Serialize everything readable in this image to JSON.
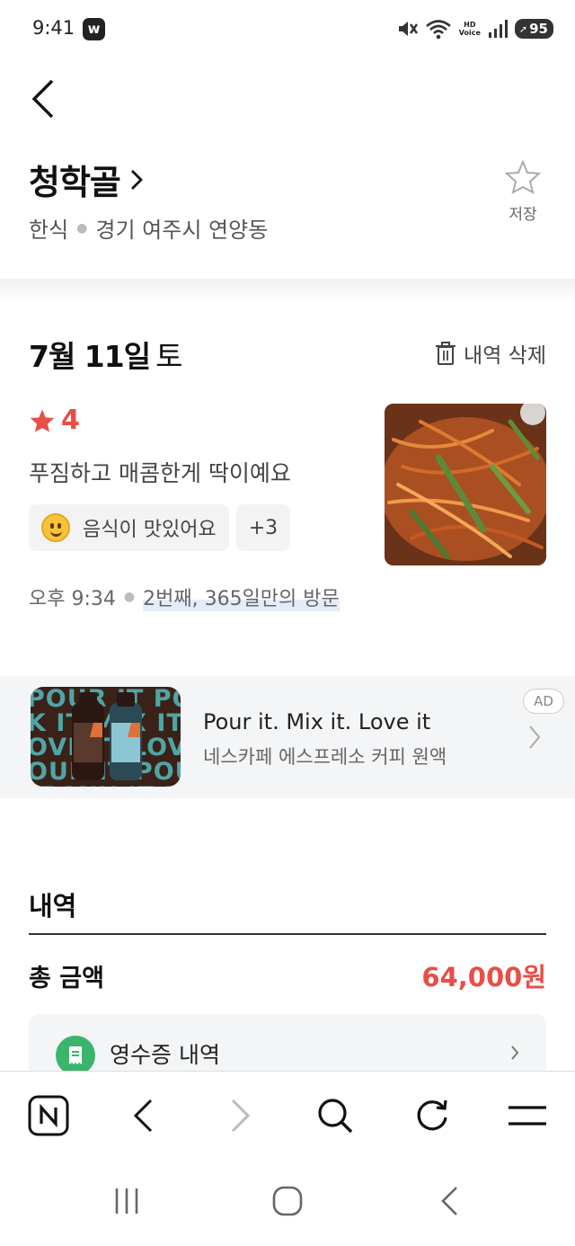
{
  "status_bar": {
    "time": "9:41",
    "app_badge": "w",
    "hd_voice": "HD\nVoice",
    "battery": "95"
  },
  "header": {
    "restaurant_name": "청학골",
    "category": "한식",
    "location": "경기 여주시 연양동",
    "save_label": "저장"
  },
  "visit": {
    "date": "7월 11일",
    "day_of_week": "토",
    "delete_label": "내역 삭제",
    "rating": "4",
    "review": "푸짐하고 매콤한게 딱이예요",
    "chips": [
      {
        "label": "음식이 맛있어요"
      },
      {
        "label": "+3"
      }
    ],
    "time": "오후 9:34",
    "visit_count": "2번째, 365일만의 방문"
  },
  "ad": {
    "title": "Pour it. Mix it. Love it",
    "description": "네스카페 에스프레소 커피 원액",
    "badge": "AD",
    "thumb_text": "POUR IT POUR\nK IT MIX IT MI\nOVE IT LOVE\nOUR IT POUR\nIT MIX IT MI"
  },
  "details": {
    "title": "내역",
    "total_label": "총 금액",
    "total_amount": "64,000원",
    "receipt_label": "영수증 내역"
  },
  "colors": {
    "accent_red": "#e94e47",
    "receipt_green": "#3bb56b"
  }
}
